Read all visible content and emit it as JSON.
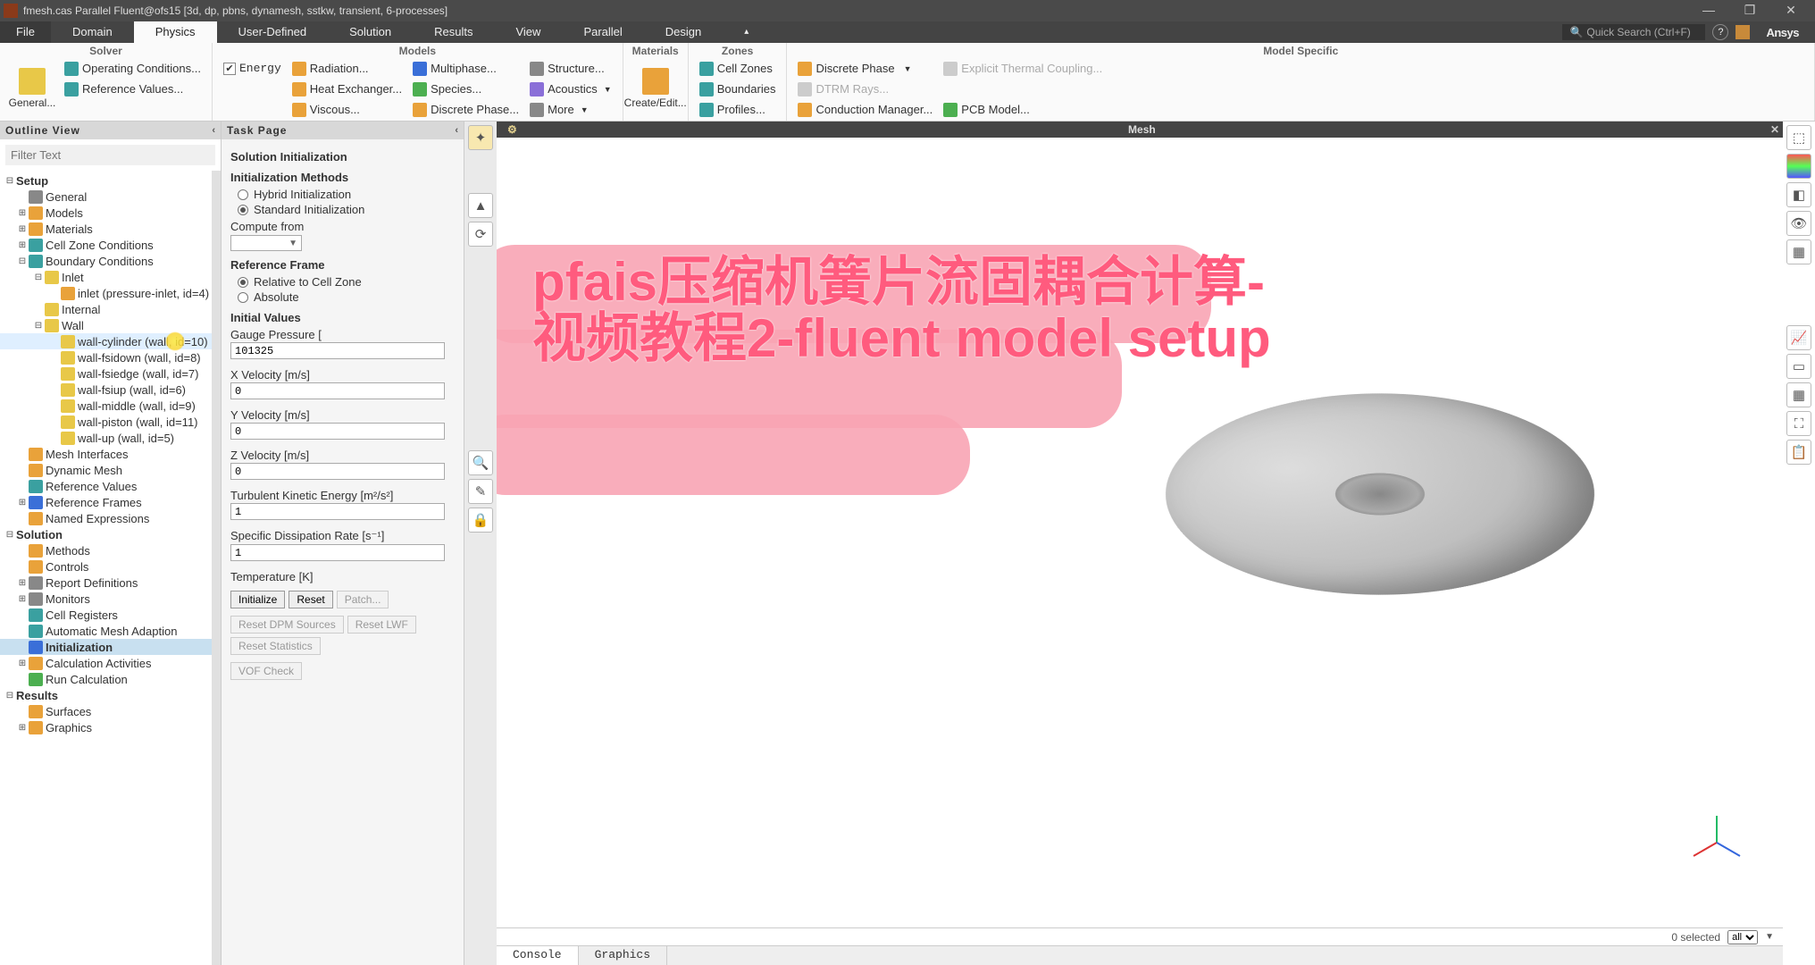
{
  "title": "fmesh.cas Parallel Fluent@ofs15  [3d, dp, pbns, dynamesh, sstkw, transient, 6-processes]",
  "menu_tabs": [
    "File",
    "Domain",
    "Physics",
    "User-Defined",
    "Solution",
    "Results",
    "View",
    "Parallel",
    "Design"
  ],
  "active_tab": "Physics",
  "quick_search_placeholder": "Quick Search (Ctrl+F)",
  "brand": "Ansys",
  "ribbon": {
    "solver": {
      "title": "Solver",
      "general": "General...",
      "operating": "Operating Conditions...",
      "reference": "Reference Values...",
      "energy": "Energy"
    },
    "models": {
      "title": "Models",
      "radiation": "Radiation...",
      "heat_ex": "Heat Exchanger...",
      "viscous": "Viscous...",
      "multiphase": "Multiphase...",
      "species": "Species...",
      "discrete_phase": "Discrete Phase...",
      "structure": "Structure...",
      "acoustics": "Acoustics",
      "more": "More"
    },
    "materials": {
      "title": "Materials",
      "create": "Create/Edit..."
    },
    "zones": {
      "title": "Zones",
      "cell": "Cell Zones",
      "boundaries": "Boundaries",
      "profiles": "Profiles..."
    },
    "model_specific": {
      "title": "Model Specific",
      "discrete_phase": "Discrete Phase",
      "dtrm": "DTRM Rays...",
      "conduction": "Conduction Manager...",
      "thermal": "Explicit Thermal Coupling...",
      "pcb": "PCB Model..."
    }
  },
  "outline": {
    "title": "Outline View",
    "filter_placeholder": "Filter Text",
    "setup": "Setup",
    "general": "General",
    "models_node": "Models",
    "materials_node": "Materials",
    "cellzone": "Cell Zone Conditions",
    "boundary": "Boundary Conditions",
    "inlet": "Inlet",
    "inlet_item": "inlet (pressure-inlet, id=4)",
    "internal": "Internal",
    "wall": "Wall",
    "wall_cylinder": "wall-cylinder (wall, id=10)",
    "wall_fsidown": "wall-fsidown (wall, id=8)",
    "wall_fsiedge": "wall-fsiedge (wall, id=7)",
    "wall_fsiup": "wall-fsiup (wall, id=6)",
    "wall_middle": "wall-middle (wall, id=9)",
    "wall_piston": "wall-piston (wall, id=11)",
    "wall_up": "wall-up (wall, id=5)",
    "mesh_interfaces": "Mesh Interfaces",
    "dynamic_mesh": "Dynamic Mesh",
    "reference_values": "Reference Values",
    "reference_frames": "Reference Frames",
    "named_expressions": "Named Expressions",
    "solution": "Solution",
    "methods": "Methods",
    "controls": "Controls",
    "report_definitions": "Report Definitions",
    "monitors": "Monitors",
    "cell_registers": "Cell Registers",
    "ama": "Automatic Mesh Adaption",
    "initialization": "Initialization",
    "calc_activities": "Calculation Activities",
    "run_calc": "Run Calculation",
    "results": "Results",
    "surfaces": "Surfaces",
    "graphics": "Graphics"
  },
  "task": {
    "title": "Task Page",
    "heading": "Solution Initialization",
    "methods_h": "Initialization Methods",
    "hybrid": "Hybrid  Initialization",
    "standard": "Standard Initialization",
    "compute_from": "Compute from",
    "ref_frame": "Reference Frame",
    "rel_cell": "Relative to Cell Zone",
    "absolute": "Absolute",
    "initial_values": "Initial Values",
    "gauge_pressure": "Gauge Pressure [",
    "gauge_val": "101325",
    "xvel": "X Velocity [m/s]",
    "xvel_val": "0",
    "yvel": "Y Velocity [m/s]",
    "yvel_val": "0",
    "zvel": "Z Velocity [m/s]",
    "zvel_val": "0",
    "tke": "Turbulent Kinetic Energy [m²/s²]",
    "tke_val": "1",
    "sdr": "Specific Dissipation Rate [s⁻¹]",
    "sdr_val": "1",
    "temp": "Temperature [K]",
    "initialize": "Initialize",
    "reset": "Reset",
    "patch": "Patch...",
    "reset_dpm": "Reset DPM Sources",
    "reset_lwf": "Reset LWF",
    "reset_stats": "Reset Statistics",
    "vof": "VOF Check"
  },
  "viewport": {
    "title": "Mesh",
    "selected": "0 selected",
    "filter": "all",
    "console_tab": "Console",
    "graphics_tab": "Graphics"
  },
  "watermark_line1": "pfais压缩机簧片流固耦合计算-",
  "watermark_line2": "视频教程2-fluent model setup"
}
